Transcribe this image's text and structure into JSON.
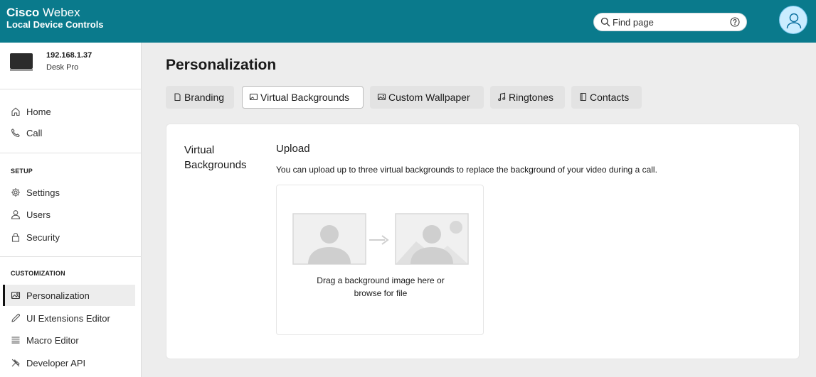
{
  "header": {
    "brand_bold": "Cisco",
    "brand_light": "Webex",
    "subtitle": "Local Device Controls",
    "search_placeholder": "Find page"
  },
  "sidebar": {
    "device": {
      "ip": "192.168.1.37",
      "model": "Desk Pro"
    },
    "top_items": [
      {
        "label": "Home",
        "icon": "home-icon"
      },
      {
        "label": "Call",
        "icon": "phone-icon"
      }
    ],
    "setup_label": "SETUP",
    "setup_items": [
      {
        "label": "Settings",
        "icon": "gear-icon"
      },
      {
        "label": "Users",
        "icon": "user-icon"
      },
      {
        "label": "Security",
        "icon": "lock-icon"
      }
    ],
    "customization_label": "CUSTOMIZATION",
    "customization_items": [
      {
        "label": "Personalization",
        "icon": "image-icon",
        "active": true
      },
      {
        "label": "UI Extensions Editor",
        "icon": "pencil-icon"
      },
      {
        "label": "Macro Editor",
        "icon": "lines-icon"
      },
      {
        "label": "Developer API",
        "icon": "tools-icon"
      }
    ]
  },
  "main": {
    "title": "Personalization",
    "tabs": [
      {
        "label": "Branding",
        "icon": "tag-icon"
      },
      {
        "label": "Virtual Backgrounds",
        "icon": "background-icon",
        "active": true
      },
      {
        "label": "Custom Wallpaper",
        "icon": "wallpaper-icon"
      },
      {
        "label": "Ringtones",
        "icon": "music-note-icon"
      },
      {
        "label": "Contacts",
        "icon": "contacts-icon"
      }
    ],
    "section_title": "Virtual Backgrounds",
    "upload_heading": "Upload",
    "upload_description": "You can upload up to three virtual backgrounds to replace the background of your video during a call.",
    "dropzone_line1": "Drag a background image here or",
    "dropzone_line2": "browse for file"
  },
  "colors": {
    "header_bg": "#0a7a8c",
    "avatar_bg": "#c9ecff",
    "page_bg": "#ededed"
  }
}
